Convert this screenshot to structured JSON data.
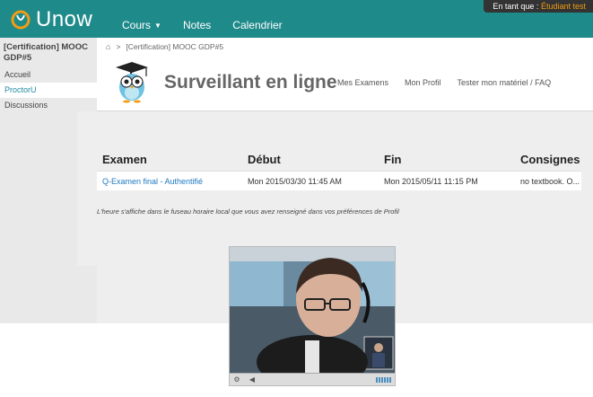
{
  "topbar": {
    "brand": "Unow",
    "nav": [
      {
        "label": "Cours",
        "has_caret": true
      },
      {
        "label": "Notes"
      },
      {
        "label": "Calendrier"
      }
    ],
    "user_prefix": "En tant que :",
    "user_name": "Étudiant test"
  },
  "sidebar": {
    "course_title": "[Certification] MOOC GDP#5",
    "items": [
      {
        "label": "Accueil",
        "active": false
      },
      {
        "label": "ProctorU",
        "active": true
      },
      {
        "label": "Discussions",
        "active": false
      }
    ]
  },
  "breadcrumb": {
    "home_icon": "home-icon",
    "separator": ">",
    "current": "[Certification] MOOC GDP#5"
  },
  "header": {
    "title": "Surveillant en ligne",
    "nav": [
      "Mes Examens",
      "Mon Profil",
      "Tester mon matériel / FAQ"
    ]
  },
  "table": {
    "columns": [
      "Examen",
      "Début",
      "Fin",
      "Consignes"
    ],
    "rows": [
      {
        "exam": "Q-Examen final - Authentifié",
        "start": "Mon 2015/03/30 11:45 AM",
        "end": "Mon 2015/05/11 11:15 PM",
        "instructions": "no textbook. O..."
      }
    ]
  },
  "timezone_note": "L'heure s'affiche dans le fuseau horaire local que vous avez renseigné dans vos préférences de Profil",
  "colors": {
    "brand_teal": "#1f8a8a",
    "accent_orange": "#f39c12",
    "link_blue": "#1f7ac0"
  }
}
